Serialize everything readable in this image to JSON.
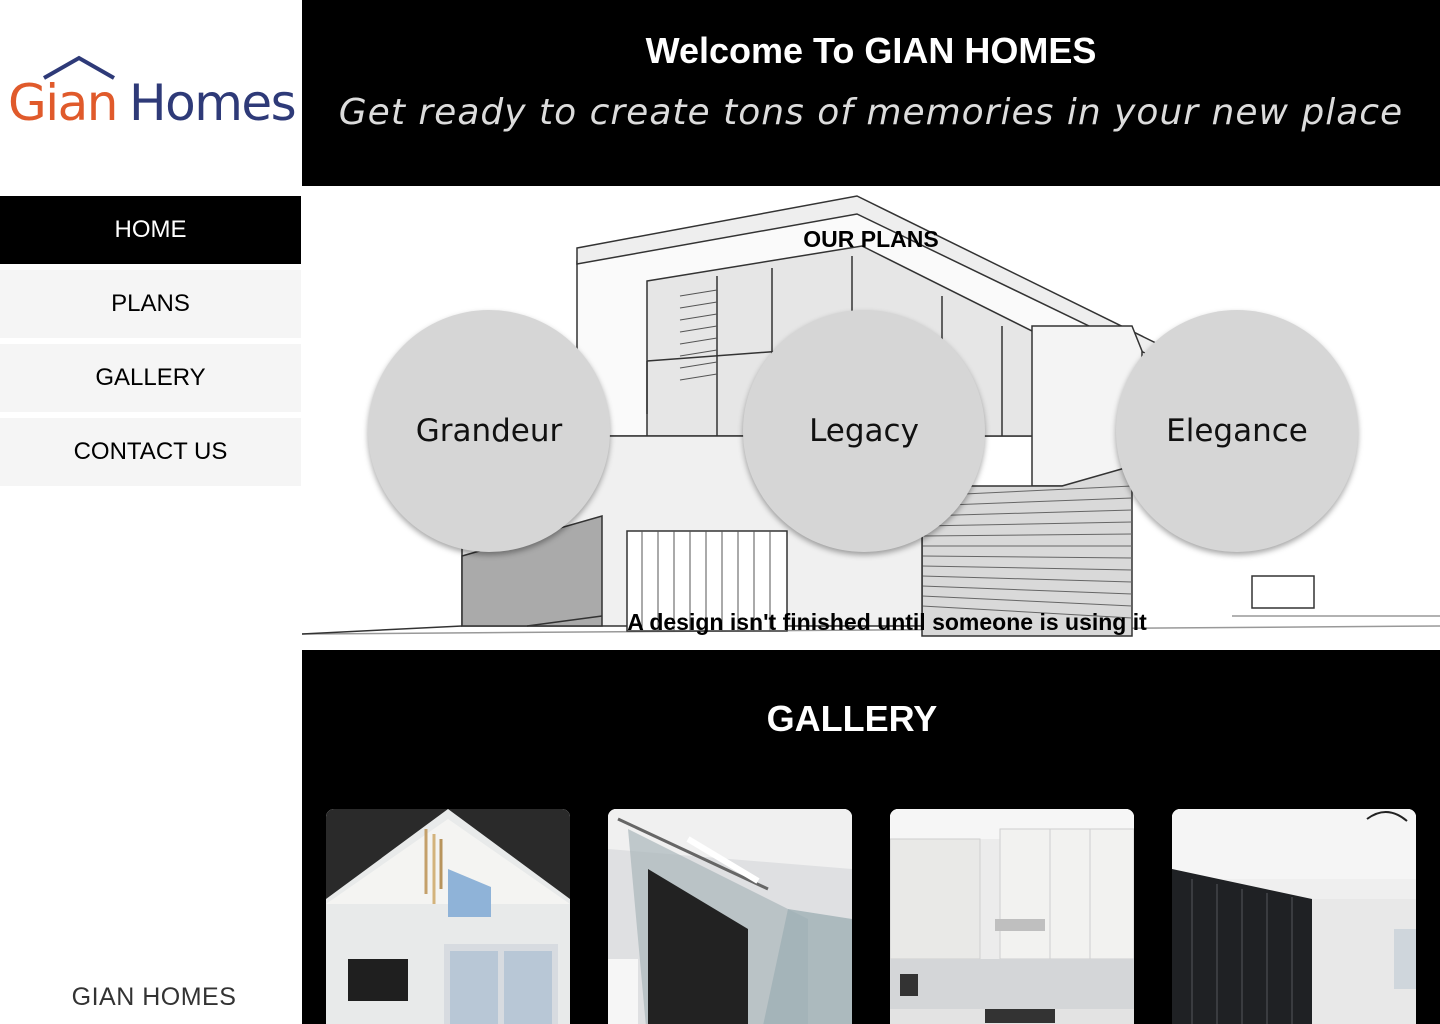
{
  "logo": {
    "word1": "Gian",
    "word2": "Homes"
  },
  "nav": {
    "items": [
      {
        "label": "HOME",
        "active": true
      },
      {
        "label": "PLANS",
        "active": false
      },
      {
        "label": "GALLERY",
        "active": false
      },
      {
        "label": "CONTACT US",
        "active": false
      }
    ]
  },
  "footer": {
    "brand": "GIAN HOMES"
  },
  "header": {
    "title": "Welcome To GIAN HOMES",
    "subtitle": "Get ready to create tons of memories in your new place"
  },
  "plans": {
    "title": "OUR PLANS",
    "items": [
      "Grandeur",
      "Legacy",
      "Elegance"
    ],
    "tagline": "A design isn't finished until someone is using it"
  },
  "gallery": {
    "title": "GALLERY",
    "photos": [
      "living-room-photo",
      "glass-staircase-photo",
      "kitchen-photo",
      "dark-panel-wall-photo"
    ]
  },
  "colors": {
    "logo_orange": "#e05a2b",
    "logo_navy": "#2e3a78",
    "header_bg": "#000000",
    "nav_active_bg": "#000000",
    "nav_bg": "#f5f5f5",
    "circle_bg": "#d6d6d6"
  }
}
